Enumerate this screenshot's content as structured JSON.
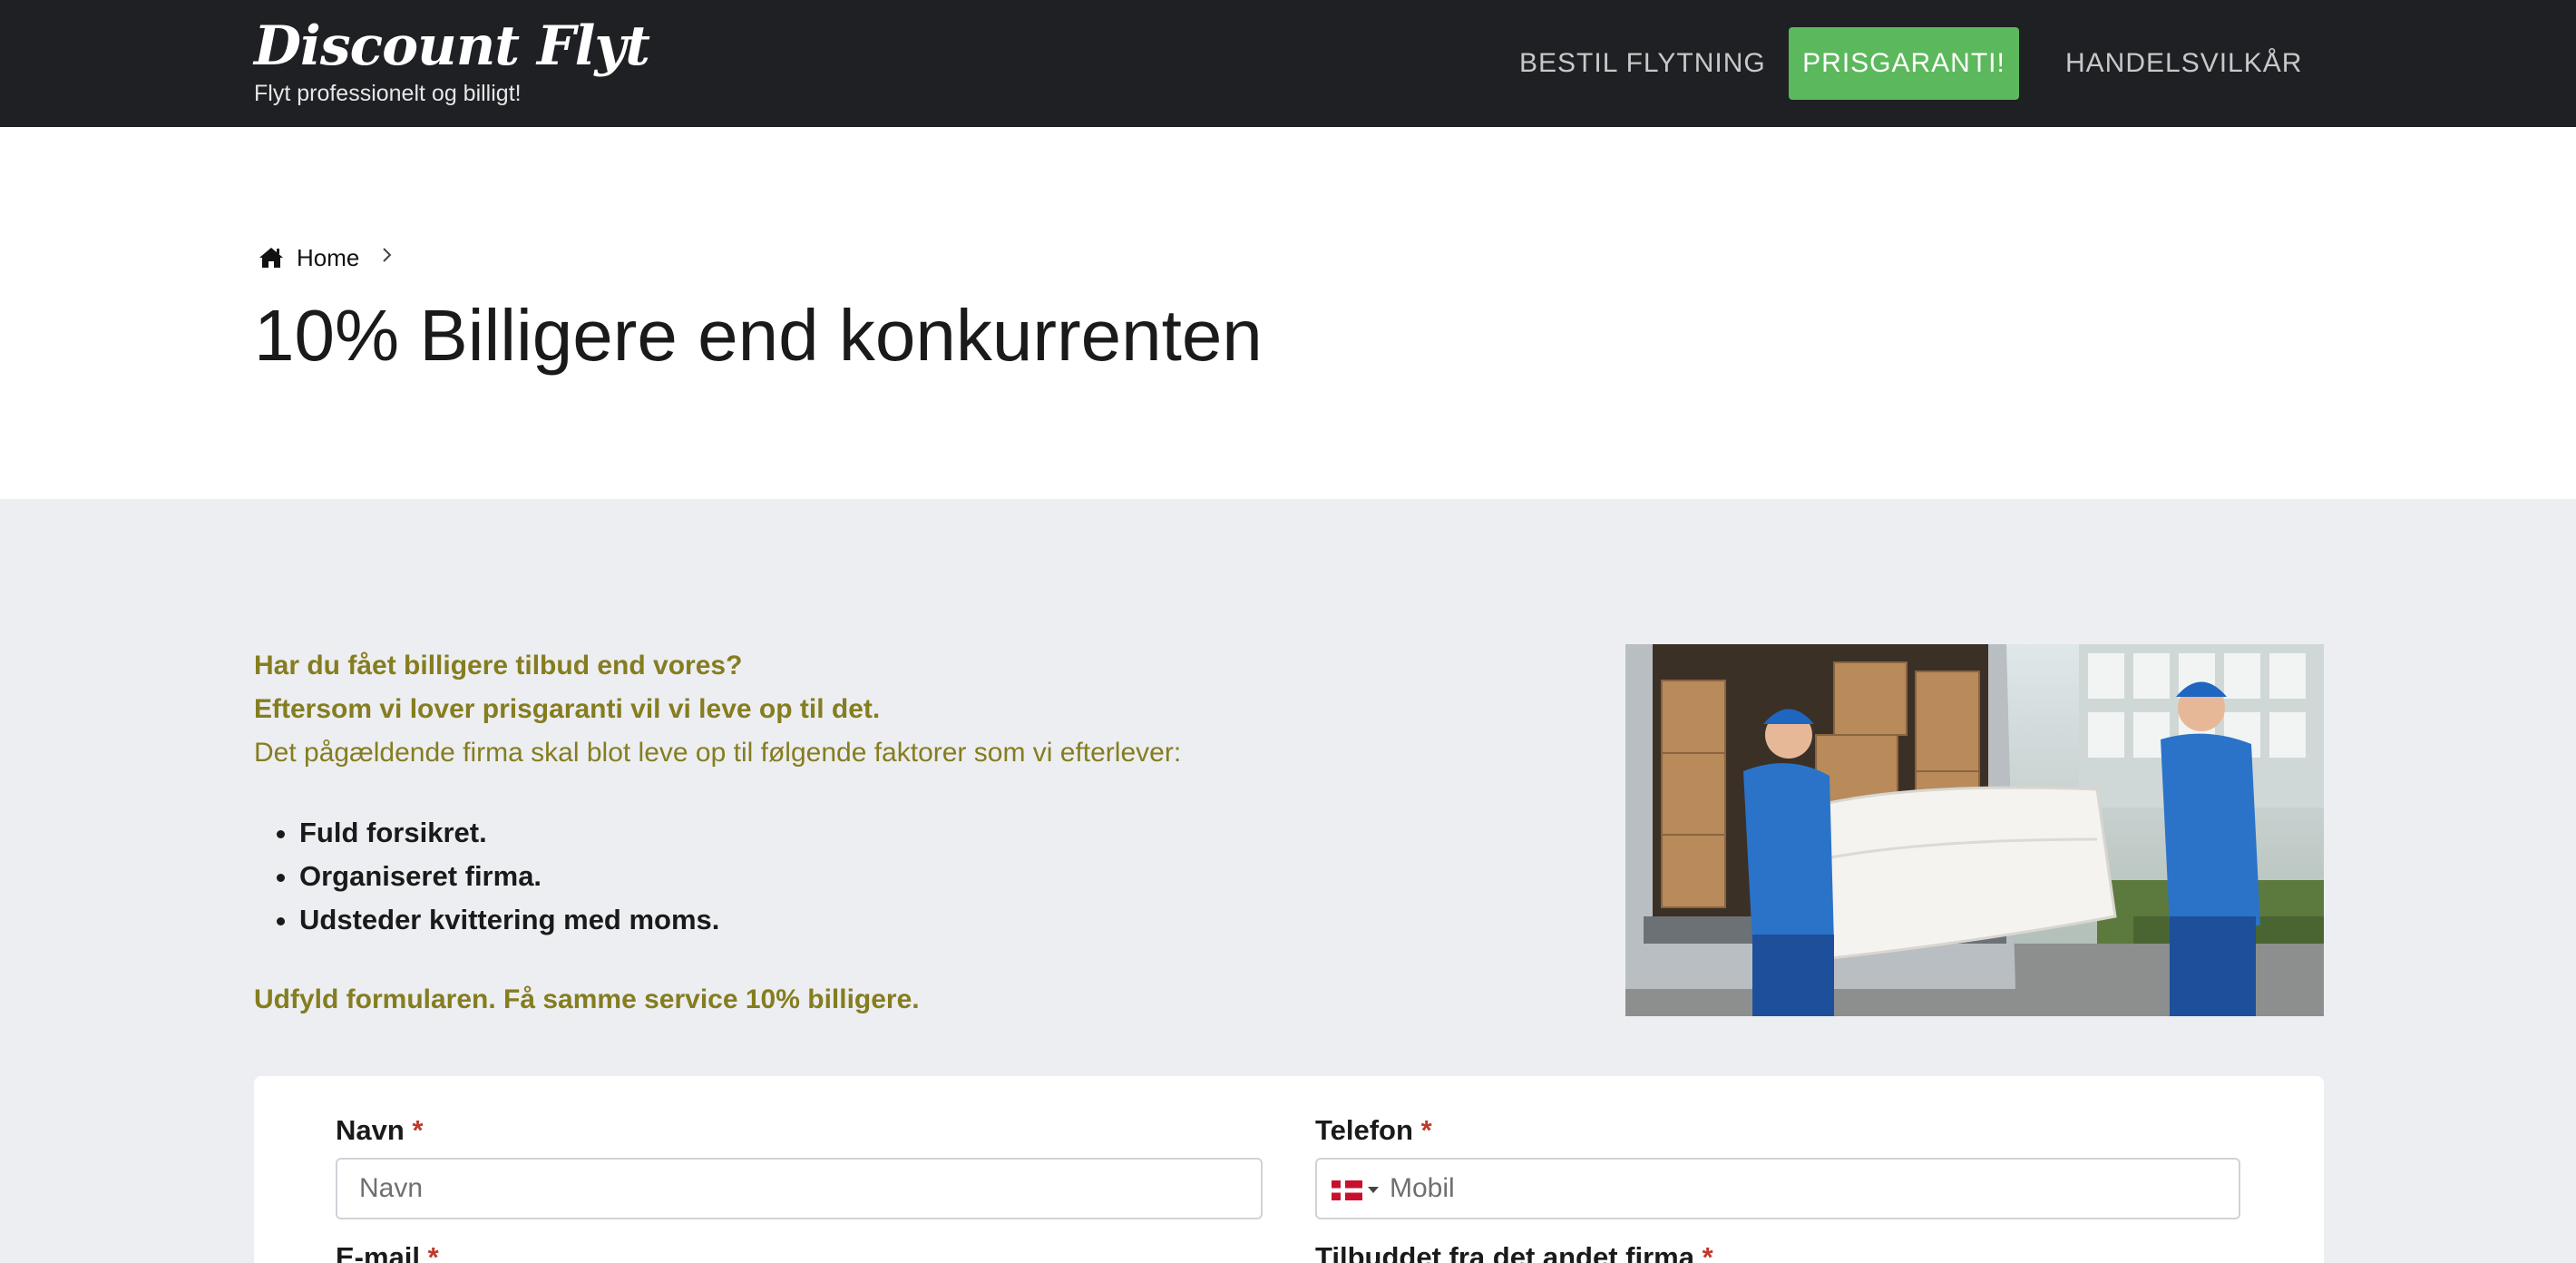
{
  "header": {
    "logo": "Discount Flyt",
    "tagline": "Flyt professionelt og billigt!",
    "nav": [
      {
        "label": "BESTIL FLYTNING"
      },
      {
        "label": "PRISGARANTI!"
      },
      {
        "label": "HANDELSVILKÅR"
      }
    ],
    "colors": {
      "bar": "#1e2024",
      "active": "#5cb85c"
    }
  },
  "breadcrumb": {
    "home": "Home"
  },
  "page_title": "10% Billigere end konkurrenten",
  "intro": {
    "line1": "Har du fået billigere tilbud end vores?",
    "line2": "Eftersom vi lover prisgaranti vil vi leve op til det.",
    "line3": "Det pågældende firma skal blot leve op til følgende faktorer som vi efterlever:",
    "requirements": [
      "Fuld forsikret.",
      "Organiseret firma.",
      "Udsteder kvittering med moms."
    ],
    "cta": "Udfyld formularen. Få samme service 10% billigere."
  },
  "form": {
    "name": {
      "label": "Navn",
      "required": "*",
      "placeholder": "Navn"
    },
    "phone": {
      "label": "Telefon",
      "required": "*",
      "placeholder": "Mobil",
      "flag_icon": "denmark-flag-icon"
    },
    "email": {
      "label": "E-mail",
      "required": "*"
    },
    "offer": {
      "label": "Tilbuddet fra det andet firma",
      "required": "*"
    }
  },
  "colors": {
    "accent_text": "#857d1f",
    "grey_bg": "#eceef1",
    "required": "#c0392b"
  }
}
